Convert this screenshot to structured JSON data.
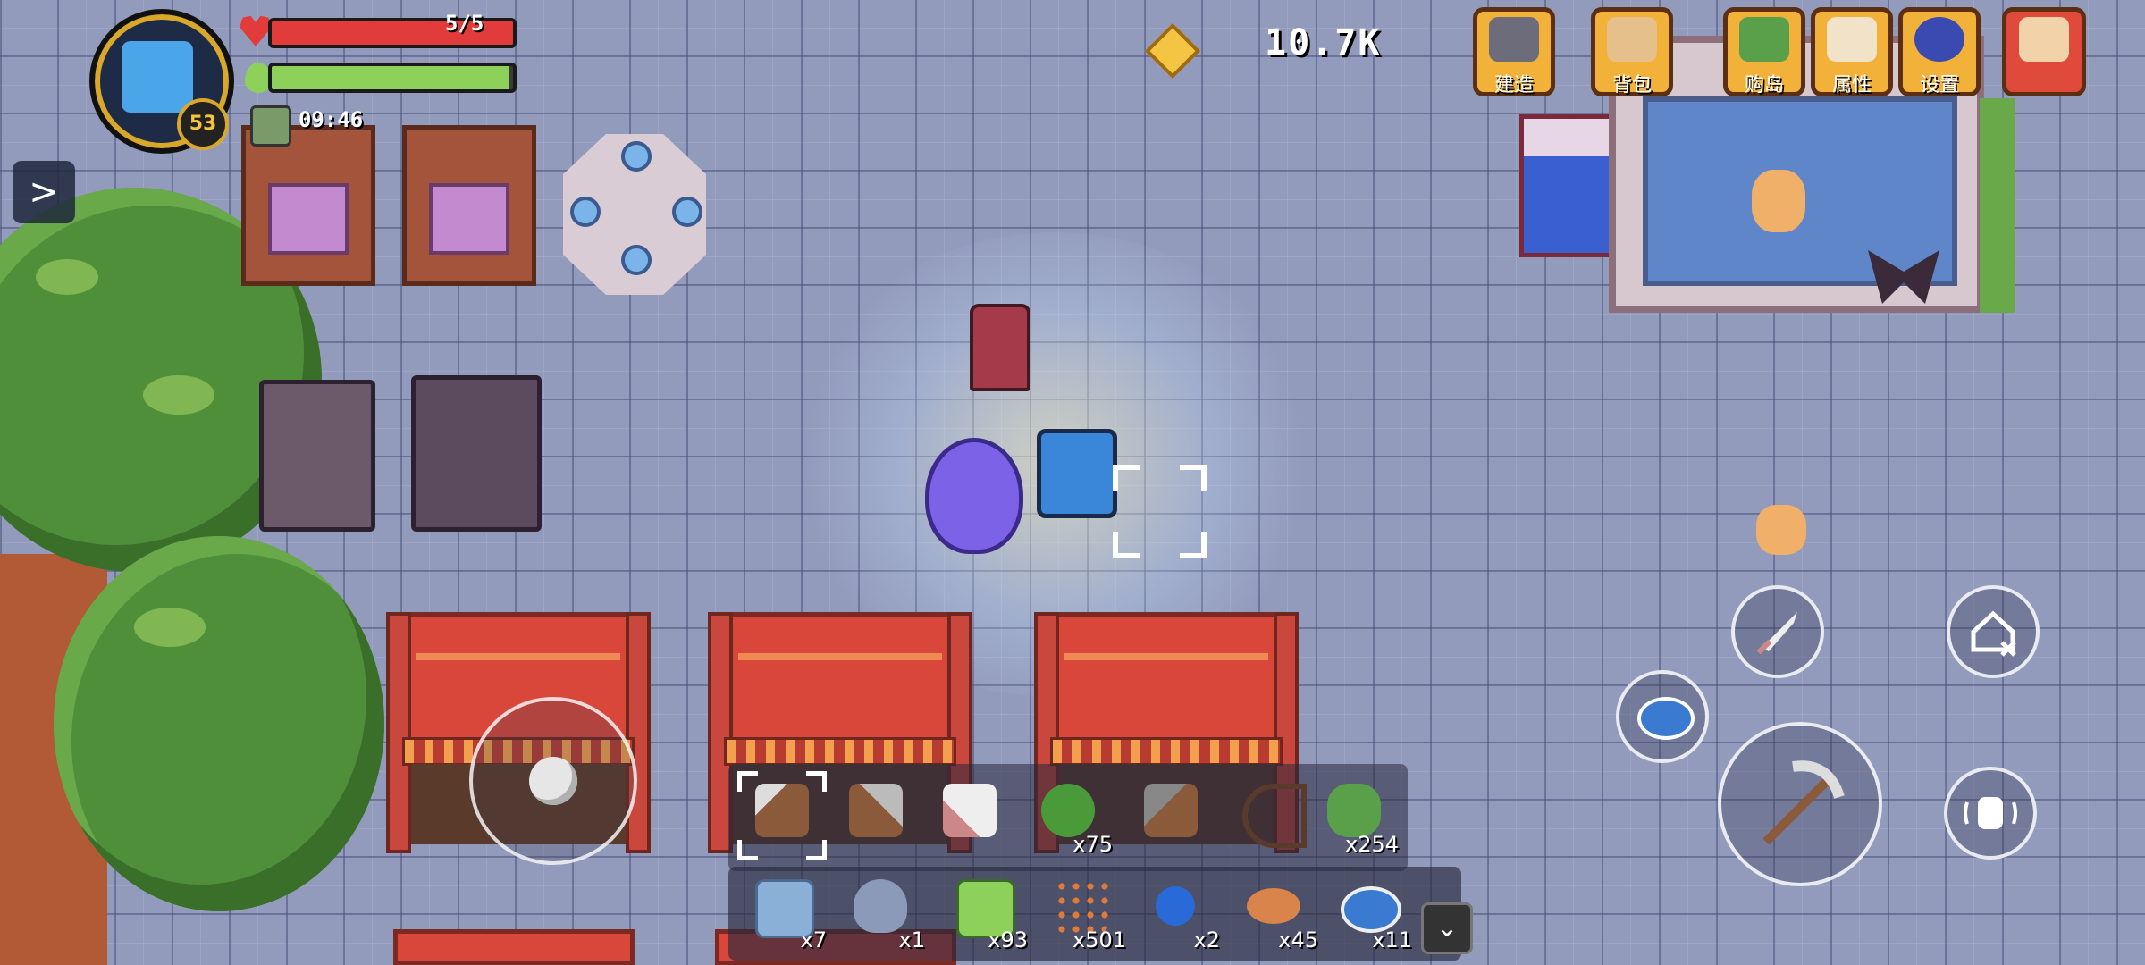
{
  "hud": {
    "player_level": "53",
    "hp_text": "5/5",
    "hp_fraction": 1.0,
    "energy_fraction": 0.98,
    "timer": "09:46",
    "currency": "10.7K"
  },
  "menu": [
    {
      "label": "建造",
      "icon": "anvil-icon"
    },
    {
      "label": "背包",
      "icon": "bag-icon"
    },
    {
      "label": "购岛",
      "icon": "island-icon"
    },
    {
      "label": "属性",
      "icon": "scroll-icon"
    },
    {
      "label": "设置",
      "icon": "gear-icon"
    }
  ],
  "hotbar": [
    {
      "icon": "pickaxe-icon",
      "count": "",
      "selected": true
    },
    {
      "icon": "shovel-icon",
      "count": ""
    },
    {
      "icon": "sword-icon",
      "count": ""
    },
    {
      "icon": "whip-icon",
      "count": "x75"
    },
    {
      "icon": "hammer-icon",
      "count": ""
    },
    {
      "icon": "bow-icon",
      "count": ""
    },
    {
      "icon": "seed-icon",
      "count": "x254"
    }
  ],
  "inventory": [
    {
      "icon": "floor-tile-icon",
      "count": "x7"
    },
    {
      "icon": "crystal-icon",
      "count": "x1"
    },
    {
      "icon": "grass-block-icon",
      "count": "x93"
    },
    {
      "icon": "ore-icon",
      "count": "x501"
    },
    {
      "icon": "bomb-icon",
      "count": "x2"
    },
    {
      "icon": "bread-icon",
      "count": "x45"
    },
    {
      "icon": "salad-icon",
      "count": "x11"
    }
  ],
  "colors": {
    "hp": "#e23b3b",
    "energy": "#8ed15a",
    "menu_button": "#f2b23a",
    "accent_gold": "#d9a82a"
  }
}
